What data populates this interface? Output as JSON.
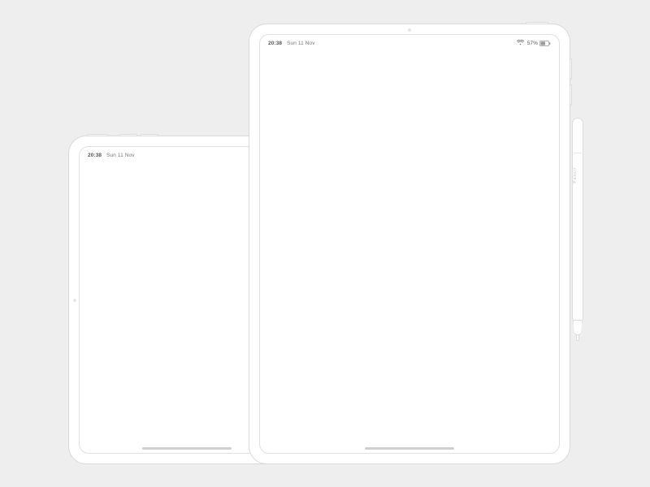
{
  "small_ipad": {
    "statusbar": {
      "time": "20:38",
      "date": "Sun 11 Nov"
    }
  },
  "big_ipad": {
    "statusbar": {
      "time": "20:38",
      "date": "Sun 11 Nov",
      "battery_text": "57%"
    }
  },
  "pencil": {
    "brand_glyph": "",
    "label": "Pencil"
  }
}
